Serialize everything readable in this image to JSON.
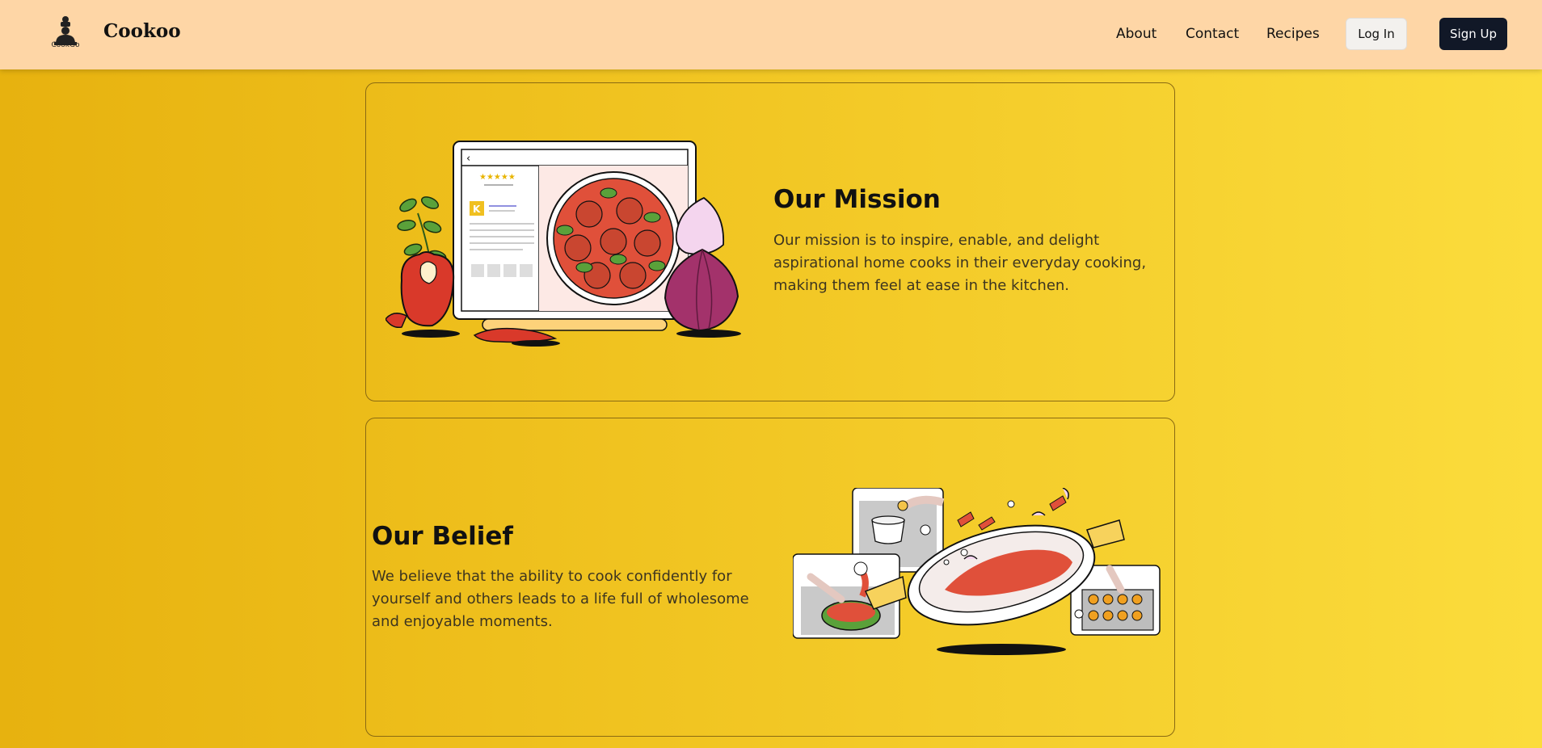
{
  "nav": {
    "brand": "Cookoo",
    "logo_text": "CookGo",
    "links": [
      "About",
      "Contact",
      "Recipes"
    ],
    "login_label": "Log In",
    "signup_label": "Sign Up"
  },
  "mission": {
    "title": "Our Mission",
    "body": "Our mission is to inspire, enable, and delight aspirational home cooks in their everyday cooking, making them feel at ease in the kitchen.",
    "illustration": "laptop-recipe-meatballs-illustration",
    "tile_letter": "K"
  },
  "belief": {
    "title": "Our Belief",
    "body": "We believe that the ability to cook confidently for yourself and others leads to a life full of wholesome and enjoyable moments.",
    "illustration": "cooking-pan-scenes-illustration"
  },
  "colors": {
    "nav_bg": "#fed6a6",
    "page_gradient_start": "#e7b20f",
    "page_gradient_end": "#fbdc3c",
    "signup_bg": "#111827",
    "card_border": "#8a6a12"
  }
}
